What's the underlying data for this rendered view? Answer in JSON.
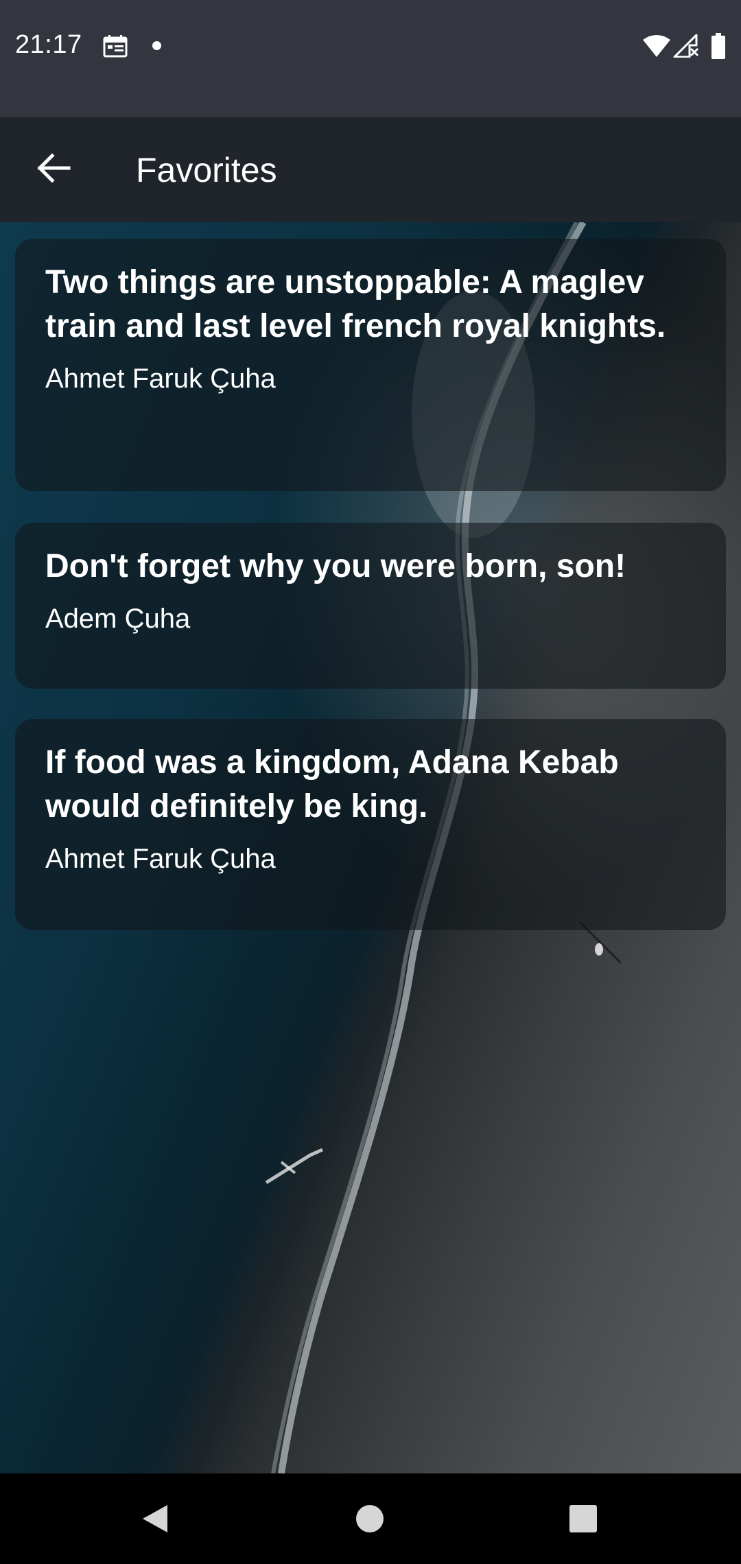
{
  "status_bar": {
    "time": "21:17",
    "icons": [
      "calendar-icon",
      "notification-dot-icon",
      "wifi-icon",
      "cellular-signal-icon",
      "battery-icon"
    ]
  },
  "app_bar": {
    "title": "Favorites",
    "back_icon": "arrow-left-icon"
  },
  "quotes": [
    {
      "text": "Two things are unstoppable: A maglev train and last level french royal knights.",
      "author": "Ahmet Faruk Çuha"
    },
    {
      "text": "Don't forget why you were born, son!",
      "author": "Adem Çuha"
    },
    {
      "text": "If food was a kingdom, Adana Kebab would definitely be king.",
      "author": "Ahmet Faruk Çuha"
    }
  ],
  "nav_bar": {
    "icons": [
      "nav-back-icon",
      "nav-home-icon",
      "nav-recents-icon"
    ]
  },
  "colors": {
    "status_bar": "#33363e",
    "app_bar": "#20252b",
    "card_background": "rgba(18,22,26,0.58)",
    "nav_bar": "#000000",
    "text": "#ffffff"
  }
}
